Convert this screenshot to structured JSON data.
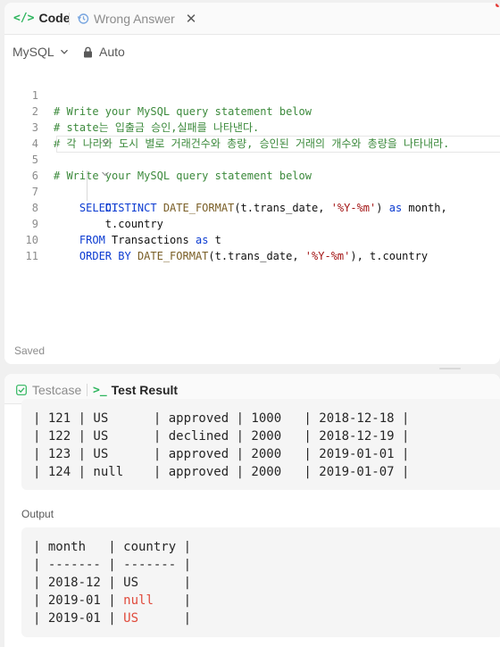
{
  "tabs": {
    "code_label": "Code",
    "code_icon": "code-icon",
    "wrong_label": "Wrong Answer",
    "wrong_icon": "history-icon"
  },
  "toolbar": {
    "language": "MySQL",
    "mode": "Auto"
  },
  "code": {
    "lines": [
      {
        "n": "1"
      },
      {
        "n": "2"
      },
      {
        "n": "3"
      },
      {
        "n": "4"
      },
      {
        "n": "5"
      },
      {
        "n": "6"
      },
      {
        "n": "7"
      },
      {
        "n": "8"
      },
      {
        "n": "9"
      },
      {
        "n": "10"
      },
      {
        "n": "11"
      }
    ],
    "c1": "# Write your MySQL query statement below",
    "c2": "# state는 입출금 승인,실패를 나타낸다.",
    "c3": "# 각 나라와 도시 별로 거래건수와 총량, 승인된 거래의 개수와 총량을 나타내라.",
    "c4": "# Write your MySQL query statement below",
    "l6_kw": "SELECT",
    "l7_kw": "DISTINCT",
    "l7_fn": "DATE_FORMAT",
    "l7_a": "(t.trans_date, ",
    "l7_str": "'%Y-%m'",
    "l7_b": ") ",
    "l7_kw2": "as",
    "l7_c": " month,",
    "l8": "t.country",
    "l9_kw": "FROM",
    "l9_a": " Transactions ",
    "l9_kw2": "as",
    "l9_b": " t",
    "l10_kw": "ORDER BY",
    "l10_fn": "DATE_FORMAT",
    "l10_a": "(t.trans_date, ",
    "l10_str": "'%Y-%m'",
    "l10_b": "), t.country"
  },
  "status": {
    "saved": "Saved"
  },
  "result_tabs": {
    "testcase_label": "Testcase",
    "testcase_icon": "checkbox-icon",
    "result_label": "Test Result",
    "result_icon": "terminal-icon"
  },
  "input_rows": [
    "| 121 | US      | approved | 1000   | 2018-12-18 |",
    "| 122 | US      | declined | 2000   | 2018-12-19 |",
    "| 123 | US      | approved | 2000   | 2019-01-01 |",
    "| 124 | null    | approved | 2000   | 2019-01-07 |"
  ],
  "output": {
    "label": "Output",
    "header": "| month   | country |",
    "divider": "| ------- | ------- |",
    "rows": [
      {
        "a": "| 2018-12 | ",
        "b": "US     ",
        "c": " |",
        "red": false
      },
      {
        "a": "| 2019-01 | ",
        "b": "null   ",
        "c": " |",
        "red": true
      },
      {
        "a": "| 2019-01 | ",
        "b": "US     ",
        "c": " |",
        "red": true
      }
    ]
  },
  "colors": {
    "accent_green": "#2db55d",
    "keyword_blue": "#0b3bd1",
    "diff_red": "#e04a3b"
  }
}
